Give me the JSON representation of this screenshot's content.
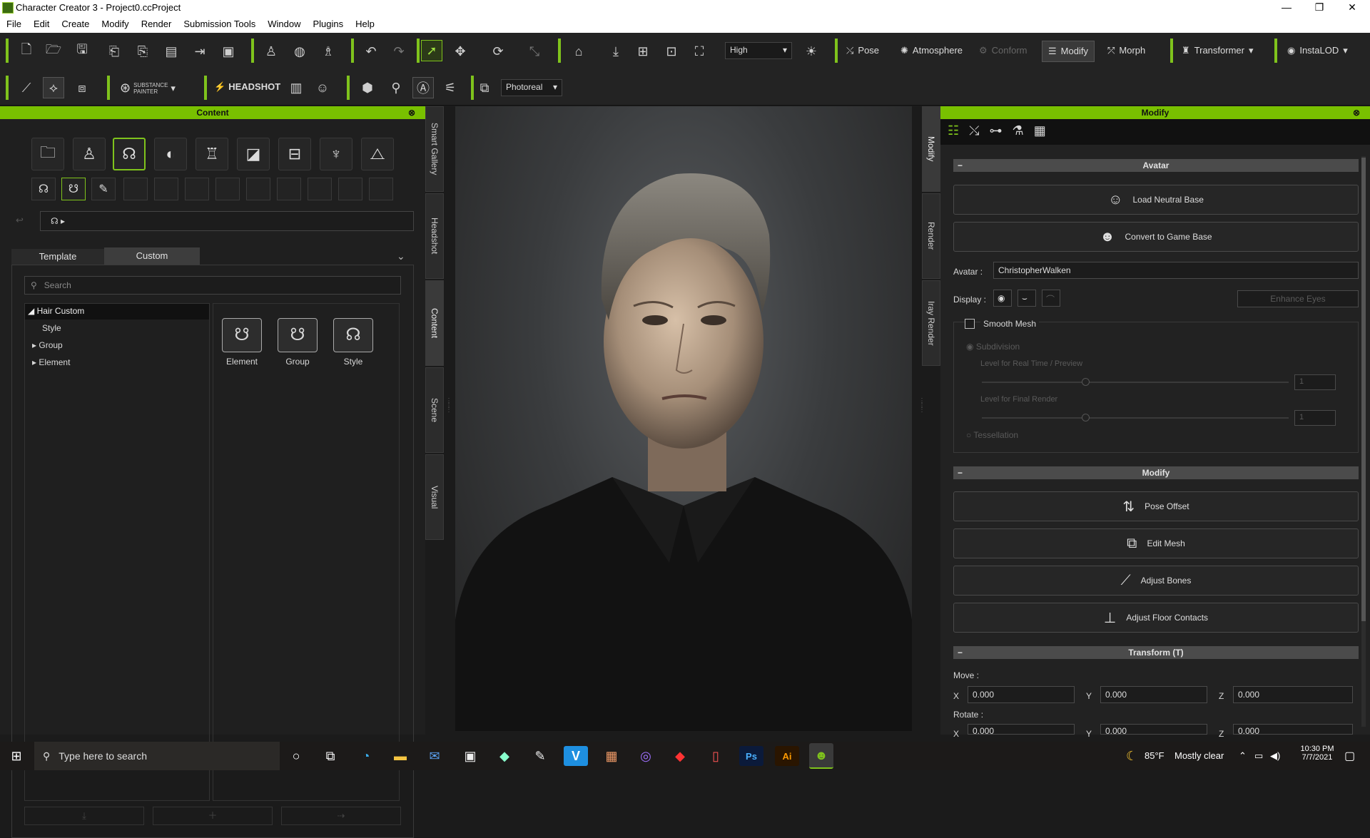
{
  "window": {
    "title": "Character Creator 3 - Project0.ccProject",
    "minimize": "—",
    "restore": "❐",
    "close": "✕"
  },
  "menu": [
    "File",
    "Edit",
    "Create",
    "Modify",
    "Render",
    "Submission Tools",
    "Window",
    "Plugins",
    "Help"
  ],
  "toolbar1": {
    "quality": "High",
    "pose": "Pose",
    "atmosphere": "Atmosphere",
    "conform": "Conform",
    "modify": "Modify",
    "morph": "Morph",
    "transformer": "Transformer",
    "instalod": "InstaLOD"
  },
  "toolbar2": {
    "substance_line1": "SUBSTANCE",
    "substance_line2": "PAINTER",
    "headshot": "HEADSHOT",
    "render_mode": "Photoreal"
  },
  "content": {
    "title": "Content",
    "tabs": [
      "Template",
      "Custom"
    ],
    "active_tab": "Custom",
    "search_placeholder": "Search",
    "tree": [
      {
        "label": "Hair Custom",
        "expanded": true
      },
      {
        "label": "Style"
      },
      {
        "label": "Group"
      },
      {
        "label": "Element"
      }
    ],
    "folders": [
      "Element",
      "Group",
      "Style"
    ]
  },
  "side_tabs": [
    "Smart Gallery",
    "Headshot",
    "Content",
    "Scene",
    "Visual"
  ],
  "right_side_tabs": [
    "Modify",
    "Render",
    "Iray Render"
  ],
  "modify": {
    "title": "Modify",
    "avatar_section": "Avatar",
    "load_neutral": "Load Neutral Base",
    "convert_game": "Convert to Game Base",
    "avatar_label": "Avatar :",
    "avatar_name": "ChristopherWalken",
    "display_label": "Display :",
    "enhance_eyes": "Enhance Eyes",
    "smooth_mesh": "Smooth Mesh",
    "subdivision": "Subdivision",
    "level_realtime": "Level for Real Time / Preview",
    "level_final": "Level for Final Render",
    "level_rt_value": "1",
    "level_final_value": "1",
    "tessellation": "Tessellation",
    "modify_section": "Modify",
    "pose_offset": "Pose Offset",
    "edit_mesh": "Edit Mesh",
    "adjust_bones": "Adjust Bones",
    "adjust_floor": "Adjust Floor Contacts",
    "transform_section": "Transform (T)",
    "move_label": "Move :",
    "rotate_label": "Rotate :",
    "x": "X",
    "y": "Y",
    "z": "Z",
    "move": {
      "x": "0.000",
      "y": "0.000",
      "z": "0.000"
    },
    "rotate": {
      "x": "0.000",
      "y": "0.000",
      "z": "0.000"
    }
  },
  "taskbar": {
    "search_placeholder": "Type here to search",
    "weather_temp": "85°F",
    "weather_desc": "Mostly clear",
    "time": "10:30 PM",
    "date": "7/7/2021"
  },
  "colors": {
    "accent": "#7fc31c",
    "panel": "#1f1f1f",
    "header_text": "#111111"
  }
}
